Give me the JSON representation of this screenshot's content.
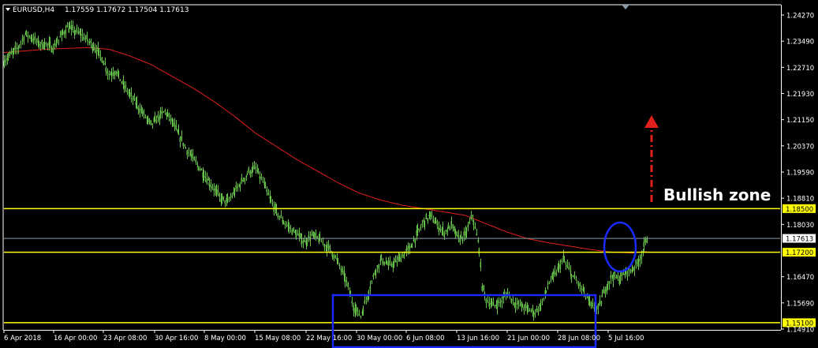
{
  "header": {
    "symbol_text": "EURUSD,H4",
    "ohlc_text": "1.17559 1.17672 1.17504 1.17613"
  },
  "annotation": {
    "text": "Bullish zone"
  },
  "colors": {
    "background": "#000000",
    "candles": "#66c24a",
    "ma": "#e0201c",
    "levels": "#ffff00",
    "price_line": "#8a9aa8",
    "box": "#1a2aff",
    "ellipse": "#1a2aff",
    "arrow": "#e0201c",
    "axis": "#ffffff",
    "grid_text": "#ffffff"
  },
  "chart_data": {
    "type": "candlestick",
    "symbol": "EURUSD",
    "timeframe": "H4",
    "y_ticks": [
      "1.24270",
      "1.23490",
      "1.22710",
      "1.21930",
      "1.21150",
      "1.20370",
      "1.19590",
      "1.18810",
      "1.18030",
      "1.16470",
      "1.15690",
      "1.14910"
    ],
    "x_ticks": [
      "6 Apr 2018",
      "16 Apr 00:00",
      "23 Apr 08:00",
      "30 Apr 16:00",
      "8 May 00:00",
      "15 May 08:00",
      "22 May 16:00",
      "30 May 00:00",
      "6 Jun 08:00",
      "13 Jun 16:00",
      "21 Jun 00:00",
      "28 Jun 08:00",
      "5 Jul 16:00"
    ],
    "ylim": [
      1.1491,
      1.2427
    ],
    "levels": [
      {
        "value": 1.185,
        "label": "1.18500"
      },
      {
        "value": 1.172,
        "label": "1.17200"
      },
      {
        "value": 1.151,
        "label": "1.15100"
      }
    ],
    "current_price": {
      "value": 1.17613,
      "label": "1.17613"
    },
    "close_path": [
      [
        0,
        1.229
      ],
      [
        5,
        1.231
      ],
      [
        10,
        1.233
      ],
      [
        15,
        1.237
      ],
      [
        20,
        1.236
      ],
      [
        25,
        1.234
      ],
      [
        30,
        1.234
      ],
      [
        35,
        1.233
      ],
      [
        40,
        1.236
      ],
      [
        45,
        1.239
      ],
      [
        50,
        1.238
      ],
      [
        55,
        1.237
      ],
      [
        60,
        1.235
      ],
      [
        65,
        1.233
      ],
      [
        70,
        1.23
      ],
      [
        75,
        1.225
      ],
      [
        80,
        1.226
      ],
      [
        85,
        1.222
      ],
      [
        90,
        1.219
      ],
      [
        95,
        1.216
      ],
      [
        100,
        1.213
      ],
      [
        105,
        1.21
      ],
      [
        110,
        1.212
      ],
      [
        115,
        1.214
      ],
      [
        120,
        1.211
      ],
      [
        125,
        1.207
      ],
      [
        130,
        1.203
      ],
      [
        135,
        1.2
      ],
      [
        140,
        1.197
      ],
      [
        145,
        1.194
      ],
      [
        150,
        1.191
      ],
      [
        155,
        1.188
      ],
      [
        160,
        1.187
      ],
      [
        165,
        1.19
      ],
      [
        170,
        1.193
      ],
      [
        175,
        1.196
      ],
      [
        180,
        1.197
      ],
      [
        185,
        1.193
      ],
      [
        190,
        1.188
      ],
      [
        195,
        1.184
      ],
      [
        200,
        1.181
      ],
      [
        205,
        1.179
      ],
      [
        210,
        1.177
      ],
      [
        215,
        1.175
      ],
      [
        220,
        1.177
      ],
      [
        225,
        1.176
      ],
      [
        230,
        1.174
      ],
      [
        235,
        1.172
      ],
      [
        240,
        1.168
      ],
      [
        245,
        1.163
      ],
      [
        250,
        1.156
      ],
      [
        255,
        1.153
      ],
      [
        260,
        1.159
      ],
      [
        265,
        1.166
      ],
      [
        270,
        1.17
      ],
      [
        275,
        1.168
      ],
      [
        280,
        1.169
      ],
      [
        285,
        1.171
      ],
      [
        290,
        1.173
      ],
      [
        295,
        1.177
      ],
      [
        300,
        1.181
      ],
      [
        305,
        1.183
      ],
      [
        310,
        1.18
      ],
      [
        315,
        1.178
      ],
      [
        320,
        1.18
      ],
      [
        325,
        1.176
      ],
      [
        330,
        1.177
      ],
      [
        335,
        1.183
      ],
      [
        340,
        1.173
      ],
      [
        342,
        1.162
      ],
      [
        345,
        1.158
      ],
      [
        350,
        1.156
      ],
      [
        355,
        1.157
      ],
      [
        360,
        1.16
      ],
      [
        365,
        1.157
      ],
      [
        370,
        1.156
      ],
      [
        375,
        1.155
      ],
      [
        380,
        1.154
      ],
      [
        385,
        1.157
      ],
      [
        390,
        1.163
      ],
      [
        395,
        1.166
      ],
      [
        400,
        1.17
      ],
      [
        405,
        1.166
      ],
      [
        410,
        1.163
      ],
      [
        415,
        1.16
      ],
      [
        420,
        1.156
      ],
      [
        425,
        1.155
      ],
      [
        430,
        1.161
      ],
      [
        435,
        1.165
      ],
      [
        440,
        1.164
      ],
      [
        445,
        1.166
      ],
      [
        450,
        1.167
      ],
      [
        455,
        1.17
      ],
      [
        460,
        1.176
      ]
    ],
    "ma_path": [
      [
        0,
        1.2315
      ],
      [
        30,
        1.2325
      ],
      [
        60,
        1.233
      ],
      [
        75,
        1.2325
      ],
      [
        90,
        1.2305
      ],
      [
        105,
        1.228
      ],
      [
        120,
        1.2245
      ],
      [
        135,
        1.221
      ],
      [
        150,
        1.217
      ],
      [
        165,
        1.2125
      ],
      [
        180,
        1.2075
      ],
      [
        195,
        1.2035
      ],
      [
        210,
        1.1995
      ],
      [
        225,
        1.196
      ],
      [
        240,
        1.1925
      ],
      [
        255,
        1.1895
      ],
      [
        270,
        1.1875
      ],
      [
        285,
        1.186
      ],
      [
        300,
        1.185
      ],
      [
        315,
        1.184
      ],
      [
        330,
        1.183
      ],
      [
        345,
        1.1805
      ],
      [
        360,
        1.178
      ],
      [
        375,
        1.176
      ],
      [
        390,
        1.1748
      ],
      [
        405,
        1.1738
      ],
      [
        420,
        1.1728
      ],
      [
        435,
        1.172
      ],
      [
        450,
        1.1718
      ],
      [
        460,
        1.1722
      ]
    ]
  }
}
